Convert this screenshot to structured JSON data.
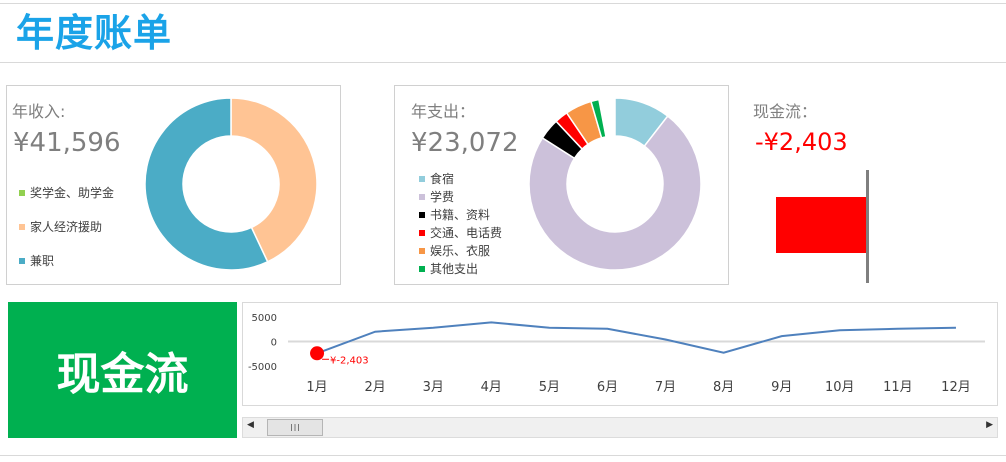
{
  "header": {
    "title": "年度账单"
  },
  "income": {
    "label": "年收入:",
    "amount": "¥41,596",
    "legend": [
      {
        "name": "奖学金、助学金",
        "color": "#92d050"
      },
      {
        "name": "家人经济援助",
        "color": "#ffc494"
      },
      {
        "name": "兼职",
        "color": "#4bacc6"
      }
    ],
    "slices": [
      {
        "name": "奖学金、助学金",
        "fraction": 0.0,
        "color": "#92d050"
      },
      {
        "name": "家人经济援助",
        "fraction": 0.43,
        "color": "#ffc494"
      },
      {
        "name": "兼职",
        "fraction": 0.57,
        "color": "#4bacc6"
      }
    ]
  },
  "expense": {
    "label": "年支出：",
    "amount": "¥23,072",
    "legend": [
      {
        "name": "食宿",
        "color": "#92cddc"
      },
      {
        "name": "学费",
        "color": "#ccc1da"
      },
      {
        "name": "书籍、资料",
        "color": "#000000"
      },
      {
        "name": "交通、电话费",
        "color": "#ff0000"
      },
      {
        "name": "娱乐、衣服",
        "color": "#f79646"
      },
      {
        "name": "其他支出",
        "color": "#00b050"
      }
    ],
    "slices": [
      {
        "name": "食宿",
        "fraction": 0.105,
        "color": "#92cddc"
      },
      {
        "name": "学费",
        "fraction": 0.735,
        "color": "#ccc1da"
      },
      {
        "name": "书籍、资料",
        "fraction": 0.04,
        "color": "#000000"
      },
      {
        "name": "交通、电话费",
        "fraction": 0.025,
        "color": "#ff0000"
      },
      {
        "name": "娱乐、衣服",
        "fraction": 0.05,
        "color": "#f79646"
      },
      {
        "name": "其他支出",
        "fraction": 0.015,
        "color": "#00b050"
      }
    ]
  },
  "cashflow_card": {
    "label": "现金流：",
    "amount": "-¥2,403",
    "value": -2403,
    "bar_color": "#ff0000",
    "amount_color": "#ff0000"
  },
  "cashflow_box": {
    "title": "现金流"
  },
  "chart_data": {
    "type": "line",
    "categories": [
      "1月",
      "2月",
      "3月",
      "4月",
      "5月",
      "6月",
      "7月",
      "8月",
      "9月",
      "10月",
      "11月",
      "12月"
    ],
    "series": [
      {
        "values": [
          -2403,
          2000,
          2800,
          3900,
          2800,
          2600,
          400,
          -2300,
          1100,
          2300,
          2600,
          2800
        ]
      }
    ],
    "yticks": [
      "5000",
      "0",
      "-5000"
    ],
    "ylim": [
      -5000,
      5000
    ],
    "highlight": {
      "index": 0,
      "label": "¥-2,403"
    },
    "line_color": "#4f81bd",
    "marker_color": "#ff0000"
  }
}
